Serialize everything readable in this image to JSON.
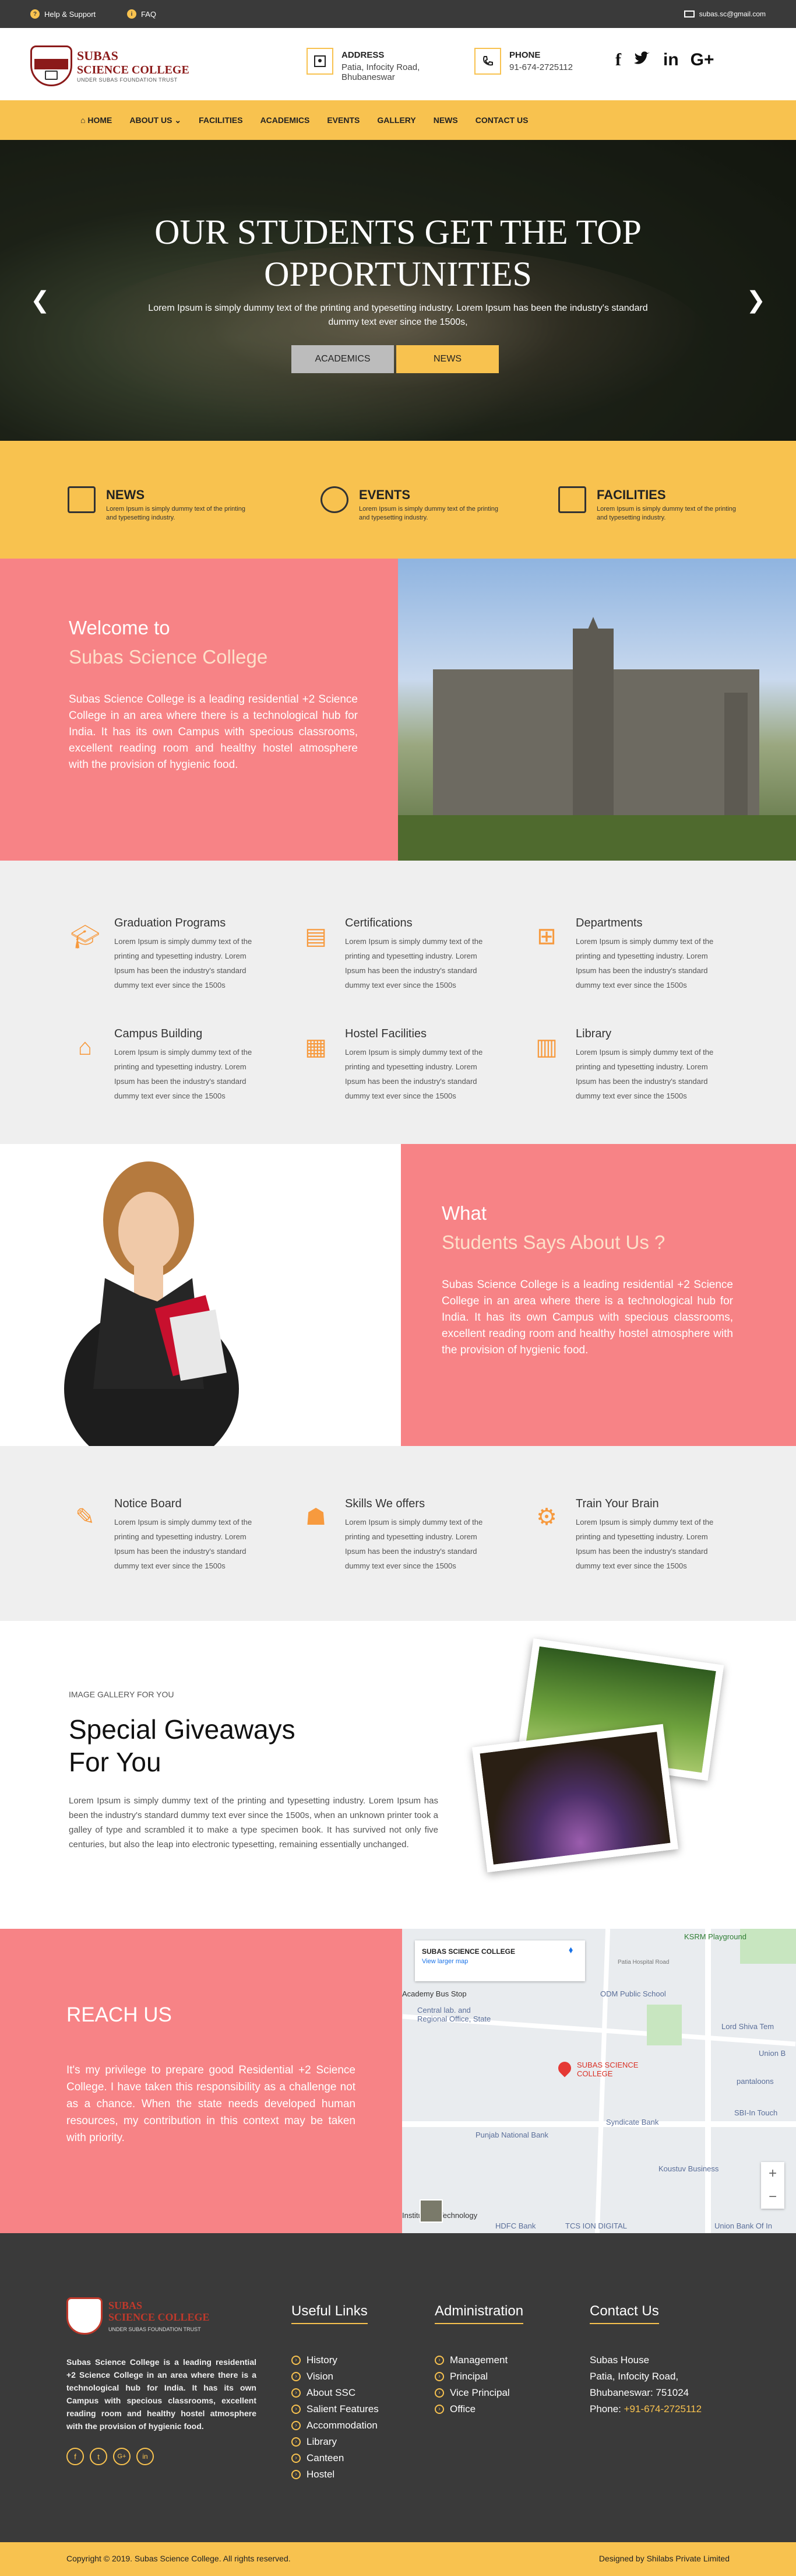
{
  "topbar": {
    "help": "Help & Support",
    "faq": "FAQ",
    "email": "subas.sc@gmail.com"
  },
  "header": {
    "logo_title_1": "SUBAS",
    "logo_title_2": "SCIENCE COLLEGE",
    "logo_sub": "UNDER SUBAS FOUNDATION TRUST",
    "address_label": "ADDRESS",
    "address_line1": "Patia, Infocity Road,",
    "address_line2": "Bhubaneswar",
    "phone_label": "PHONE",
    "phone": "91-674-2725112",
    "social": [
      "f",
      "t",
      "in",
      "G+"
    ]
  },
  "nav": [
    "HOME",
    "ABOUT US",
    "FACILITIES",
    "ACADEMICS",
    "EVENTS",
    "GALLERY",
    "NEWS",
    "CONTACT US"
  ],
  "hero": {
    "title_1": "OUR STUDENTS GET THE TOP",
    "title_2": "OPPORTUNITIES",
    "text": "Lorem Ipsum is simply dummy text of the printing and typesetting industry. Lorem Ipsum has been the industry's standard dummy text ever since the 1500s,",
    "btn_academics": "ACADEMICS",
    "btn_news": "NEWS"
  },
  "features": [
    {
      "title": "NEWS",
      "text": "Lorem Ipsum is simply dummy text of the printing and typesetting industry."
    },
    {
      "title": "EVENTS",
      "text": "Lorem Ipsum is simply dummy text of the printing and typesetting industry."
    },
    {
      "title": "FACILITIES",
      "text": "Lorem Ipsum is simply dummy text of the printing and typesetting industry."
    }
  ],
  "welcome": {
    "heading": "Welcome to",
    "subheading": "Subas Science College",
    "text": "Subas Science College is a leading residential +2 Science College in an area where there is a technological hub for India. It has its own Campus with specious classrooms, excellent reading room and healthy hostel atmosphere with the provision of hygienic food."
  },
  "services": [
    {
      "title": "Graduation Programs",
      "text": "Lorem Ipsum is simply dummy text of the printing and typesetting industry. Lorem Ipsum has been the industry's standard dummy text ever since the 1500s"
    },
    {
      "title": "Certifications",
      "text": "Lorem Ipsum is simply dummy text of the printing and typesetting industry. Lorem Ipsum has been the industry's standard dummy text ever since the 1500s"
    },
    {
      "title": "Departments",
      "text": "Lorem Ipsum is simply dummy text of the printing and typesetting industry. Lorem Ipsum has been the industry's standard dummy text ever since the 1500s"
    },
    {
      "title": "Campus Building",
      "text": "Lorem Ipsum is simply dummy text of the printing and typesetting industry. Lorem Ipsum has been the industry's standard dummy text ever since the 1500s"
    },
    {
      "title": "Hostel Facilities",
      "text": "Lorem Ipsum is simply dummy text of the printing and typesetting industry. Lorem Ipsum has been the industry's standard dummy text ever since the 1500s"
    },
    {
      "title": "Library",
      "text": "Lorem Ipsum is simply dummy text of the printing and typesetting industry. Lorem Ipsum has been the industry's standard dummy text ever since the 1500s"
    }
  ],
  "testimonial": {
    "heading": "What",
    "subheading": "Students Says About Us ?",
    "text": "Subas Science College is a leading residential +2 Science College in an area where there is a technological hub for India. It has its own Campus with specious classrooms, excellent reading room and healthy hostel atmosphere with the provision of hygienic food."
  },
  "skills": [
    {
      "title": "Notice Board",
      "text": "Lorem Ipsum is simply dummy text of the printing and typesetting industry. Lorem Ipsum has been the industry's standard dummy text ever since the 1500s"
    },
    {
      "title": "Skills We offers",
      "text": "Lorem Ipsum is simply dummy text of the printing and typesetting industry. Lorem Ipsum has been the industry's standard dummy text ever since the 1500s"
    },
    {
      "title": "Train Your Brain",
      "text": "Lorem Ipsum is simply dummy text of the printing and typesetting industry. Lorem Ipsum has been the industry's standard dummy text ever since the 1500s"
    }
  ],
  "gallery": {
    "kicker": "IMAGE GALLERY FOR YOU",
    "title_1": "Special  Giveaways",
    "title_2": "For You",
    "text": "Lorem Ipsum is simply dummy text of the printing and typesetting industry. Lorem Ipsum has been the industry's standard dummy text ever since the 1500s, when an unknown printer took a galley of type and scrambled it to make a type specimen book. It has survived not only five centuries, but also the leap into electronic typesetting, remaining essentially unchanged."
  },
  "reach": {
    "heading": "REACH US",
    "text": "It's my privilege to prepare good Residential +2 Science College. I have taken this responsibility as a challenge not as a chance. When the state needs developed human resources, my contribution in this context may be taken with priority."
  },
  "map": {
    "card_title": "SUBAS SCIENCE COLLEGE",
    "card_link": "View larger map",
    "pin_label_1": "SUBAS SCIENCE",
    "pin_label_2": "COLLEGE",
    "labels": [
      "KSRM Playground",
      "Academy Bus Stop",
      "Central lab. and Regional Office, State",
      "ODM Public School",
      "Lord Shiva Tem",
      "Union B",
      "pantaloons",
      "SBI-In Touch",
      "Syndicate Bank",
      "Punjab National Bank",
      "Koustuv Business",
      "HDFC Bank",
      "TCS ION DIGITAL",
      "Union Bank Of In",
      "Institute of Technology",
      "Patia Hospital Road"
    ],
    "zoom_in": "+",
    "zoom_out": "−"
  },
  "footer": {
    "about": "Subas Science College is a leading residential +2 Science College in an area where there is a technological hub for India. It has its own Campus with specious classrooms, excellent reading room and healthy hostel atmosphere with the provision of hygienic food.",
    "useful_heading": "Useful Links",
    "useful_links": [
      "History",
      "Vision",
      "About SSC",
      "Salient Features",
      "Accommodation",
      "Library",
      "Canteen",
      "Hostel"
    ],
    "admin_heading": "Administration",
    "admin_links": [
      "Management",
      "Principal",
      "Vice Principal",
      "Office"
    ],
    "contact_heading": "Contact Us",
    "contact_name": "Subas House",
    "contact_line1": "Patia, Infocity Road,",
    "contact_line2": "Bhubaneswar: 751024",
    "contact_phone_label": "Phone:",
    "contact_phone": "+91-674-2725112",
    "social": [
      "f",
      "t",
      "G+",
      "in"
    ]
  },
  "copyright": {
    "left": "Copyright © 2019. Subas Science College. All rights reserved.",
    "right": "Designed by Shilabs Private Limited"
  },
  "colors": {
    "accent": "#f8c24f",
    "coral": "#f78386",
    "dark": "#3a3a3a",
    "grey_bg": "#efefef"
  }
}
